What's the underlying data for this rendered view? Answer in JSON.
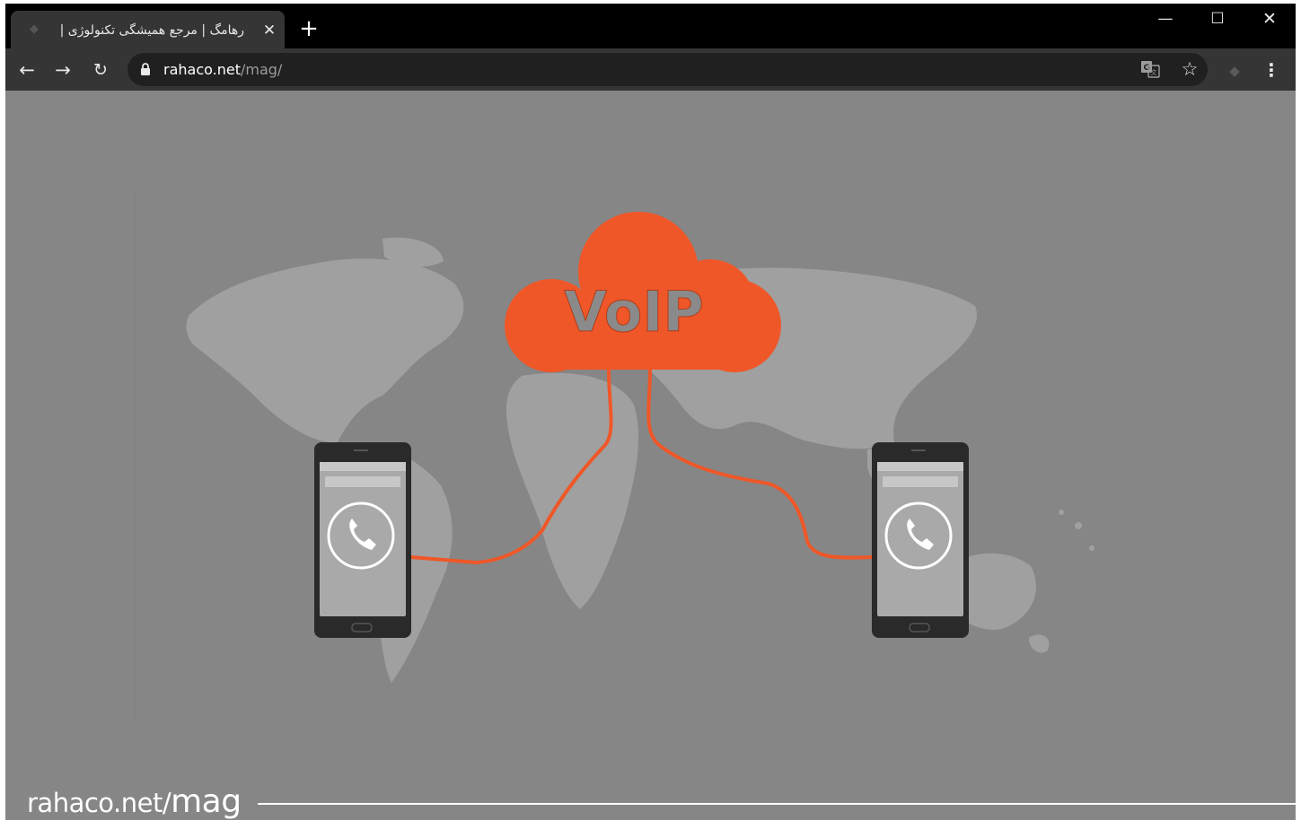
{
  "browser": {
    "tab": {
      "title": "رهامگ | مرجع همیشگی تکنولوژی |",
      "favicon": "site-logo-icon",
      "close_icon": "close-icon"
    },
    "new_tab_icon": "plus-icon",
    "window_controls": {
      "minimize": "—",
      "maximize": "☐",
      "close": "✕"
    },
    "toolbar": {
      "back_icon": "arrow-left-icon",
      "forward_icon": "arrow-right-icon",
      "reload_icon": "reload-icon",
      "url_host": "rahaco.net",
      "url_path": "/mag/",
      "translate_icon": "translate-icon",
      "bookmark_icon": "star-icon",
      "extension_icon": "extension-icon",
      "menu_icon": "kebab-menu-icon"
    }
  },
  "content": {
    "cloud_text": "VoIP",
    "watermark_host": "rahaco.net/",
    "watermark_path": "mag",
    "colors": {
      "background": "#868686",
      "cloud": "#ef5728",
      "cable": "#ef5728",
      "map": "#a3a3a3",
      "phone": "#2a2a2a"
    }
  }
}
